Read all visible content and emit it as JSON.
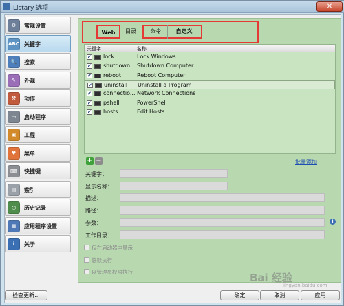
{
  "window": {
    "title": "Listary 选项",
    "close_glyph": "✕"
  },
  "sidebar": {
    "items": [
      {
        "label": "常规设置",
        "icon": "settings-icon",
        "color": "#6d7f99",
        "glyph": "⚙"
      },
      {
        "label": "关键字",
        "icon": "abc-icon",
        "color": "#5d94c4",
        "glyph": "ABC",
        "active": true
      },
      {
        "label": "搜索",
        "icon": "magnifier-icon",
        "color": "#4e7fbd",
        "glyph": "🔍"
      },
      {
        "label": "外观",
        "icon": "paint-brush-icon",
        "color": "#9b6fb8",
        "glyph": "✎"
      },
      {
        "label": "动作",
        "icon": "hammer-icon",
        "color": "#c15a3d",
        "glyph": "⚒"
      },
      {
        "label": "启动程序",
        "icon": "window-icon",
        "color": "#7e8791",
        "glyph": "▭"
      },
      {
        "label": "工程",
        "icon": "box-icon",
        "color": "#d28a2b",
        "glyph": "▣"
      },
      {
        "label": "菜单",
        "icon": "heart-menu-icon",
        "color": "#e0743a",
        "glyph": "♥"
      },
      {
        "label": "快捷键",
        "icon": "keyboard-icon",
        "color": "#8b8f94",
        "glyph": "⌨"
      },
      {
        "label": "索引",
        "icon": "drive-icon",
        "color": "#9aa1a8",
        "glyph": "▤"
      },
      {
        "label": "历史记录",
        "icon": "clock-icon",
        "color": "#4f8d4c",
        "glyph": "◷"
      },
      {
        "label": "应用程序设置",
        "icon": "app-grid-icon",
        "color": "#4f79b6",
        "glyph": "▦"
      },
      {
        "label": "关于",
        "icon": "info-icon",
        "color": "#3a6fb3",
        "glyph": "i"
      }
    ]
  },
  "tabs": [
    {
      "label": "Web"
    },
    {
      "label": "目录"
    },
    {
      "label": "命令"
    },
    {
      "label": "自定义"
    }
  ],
  "list": {
    "columns": [
      "关键字",
      "名称"
    ],
    "rows": [
      {
        "checked": true,
        "keyword": "lock",
        "name": "Lock Windows"
      },
      {
        "checked": true,
        "keyword": "shutdown",
        "name": "Shutdown Computer"
      },
      {
        "checked": true,
        "keyword": "reboot",
        "name": "Reboot Computer"
      },
      {
        "checked": true,
        "keyword": "uninstall",
        "name": "Uninstall a Program",
        "selected": true
      },
      {
        "checked": true,
        "keyword": "connectio...",
        "name": "Network Connections"
      },
      {
        "checked": true,
        "keyword": "pshell",
        "name": "PowerShell"
      },
      {
        "checked": true,
        "keyword": "hosts",
        "name": "Edit Hosts"
      }
    ],
    "check_glyph": "✔"
  },
  "actions": {
    "add": "+",
    "remove": "−",
    "batch_add": "批量添加"
  },
  "form": {
    "keyword_label": "关键字：",
    "display_name_label": "显示名称：",
    "description_label": "描述：",
    "path_label": "路径：",
    "params_label": "参数：",
    "workdir_label": "工作目录：",
    "info_glyph": "i"
  },
  "options": [
    {
      "label": "仅在启动器中显示"
    },
    {
      "label": "静默执行"
    },
    {
      "label": "以管理员权限执行"
    }
  ],
  "buttons": {
    "check_update": "检查更新...",
    "ok": "确定",
    "cancel": "取消",
    "apply": "应用"
  },
  "watermark": {
    "main": "Bai 经验",
    "sub": "jingyan.baidu.com"
  }
}
